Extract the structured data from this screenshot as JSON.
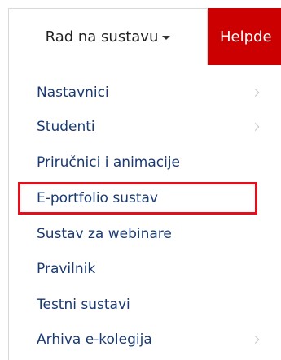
{
  "navbar": {
    "active_menu": {
      "label": "Rad na sustavu",
      "icon": "caret-down-icon"
    },
    "next_menu": {
      "label": "Helpde"
    }
  },
  "dropdown": {
    "items": [
      {
        "label": "Nastavnici",
        "has_submenu": true
      },
      {
        "label": "Studenti",
        "has_submenu": true
      },
      {
        "label": "Priručnici i animacije",
        "has_submenu": false
      },
      {
        "label": "E-portfolio sustav",
        "has_submenu": false,
        "highlighted": true
      },
      {
        "label": "Sustav za webinare",
        "has_submenu": false
      },
      {
        "label": "Pravilnik",
        "has_submenu": false
      },
      {
        "label": "Testni sustavi",
        "has_submenu": false
      },
      {
        "label": "Arhiva e-kolegija",
        "has_submenu": true
      }
    ]
  },
  "colors": {
    "link": "#1a3a73",
    "nav_red": "#cc0000",
    "highlight_border": "#e3101c"
  }
}
